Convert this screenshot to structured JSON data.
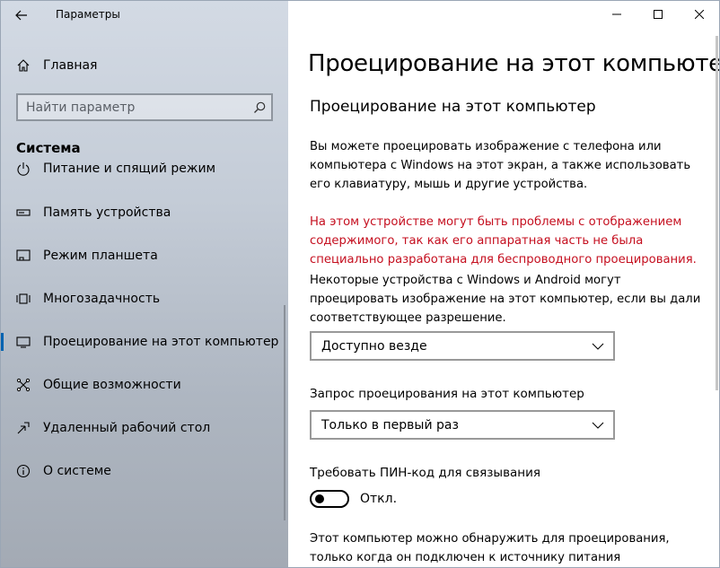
{
  "window": {
    "app_title": "Параметры",
    "icons": {
      "back": "back-arrow-icon",
      "minimize": "minimize-icon",
      "maximize": "maximize-icon",
      "close": "close-icon"
    }
  },
  "sidebar": {
    "home_label": "Главная",
    "search_placeholder": "Найти параметр",
    "section_title": "Система",
    "items": [
      {
        "label": "Питание и спящий режим",
        "icon": "power-icon"
      },
      {
        "label": "Память устройства",
        "icon": "storage-icon"
      },
      {
        "label": "Режим планшета",
        "icon": "tablet-mode-icon"
      },
      {
        "label": "Многозадачность",
        "icon": "multitasking-icon"
      },
      {
        "label": "Проецирование на этот компьютер",
        "icon": "projecting-icon",
        "active": true
      },
      {
        "label": "Общие возможности",
        "icon": "shared-experiences-icon"
      },
      {
        "label": "Удаленный рабочий стол",
        "icon": "remote-desktop-icon"
      },
      {
        "label": "О системе",
        "icon": "info-icon"
      }
    ]
  },
  "main": {
    "page_title": "Проецирование на этот компьютер",
    "section_title": "Проецирование на этот компьютер",
    "intro_lines": [
      "Вы можете проецировать изображение с телефона или",
      "компьютера с Windows на этот экран, а также использовать",
      "его клавиатуру, мышь и другие устройства."
    ],
    "warning_lines": [
      "На этом устройстве могут быть проблемы с отображением",
      "содержимого, так как его аппаратная часть не была",
      "специально разработана для беспроводного проецирования."
    ],
    "availability_lines": [
      "Некоторые устройства с Windows и Android могут",
      "проецировать изображение на этот компьютер, если вы дали",
      "соответствующее разрешение."
    ],
    "availability_value": "Доступно везде",
    "ask_label": "Запрос проецирования на этот компьютер",
    "ask_value": "Только в первый раз",
    "pin_label": "Требовать ПИН-код для связывания",
    "pin_state": "Откл.",
    "discover_lines": [
      "Этот компьютер можно обнаружить для проецирования,",
      "только когда он подключен к источнику питания"
    ]
  },
  "colors": {
    "accent": "#0063b1",
    "warning": "#c50f1f"
  }
}
